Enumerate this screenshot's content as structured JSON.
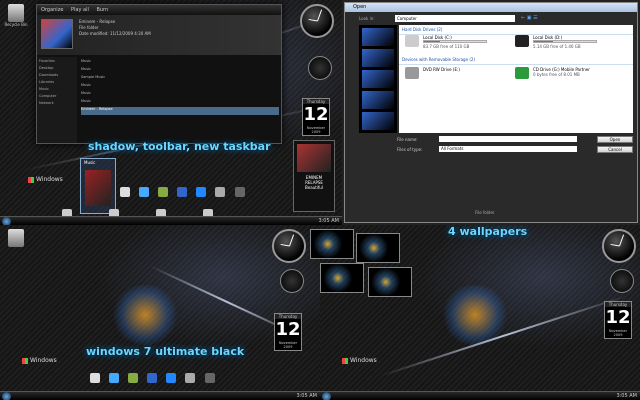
{
  "captions": {
    "top_left": "shadow, toolbar, new taskbar",
    "bottom_left": "windows 7 ultimate black",
    "bottom_right": "4 wallpapers"
  },
  "desktop": {
    "recycle_bin": "Recycle Bin",
    "windows_logo": "Windows",
    "taskbar_time": "3:05 AM"
  },
  "calendar": {
    "day_of_week": "Thursday",
    "day": "12",
    "month_year": "November 2009"
  },
  "explorer": {
    "toolbar": [
      "Organize",
      "Play all",
      "Burn"
    ],
    "meta_lines": [
      "Eminem - Relapse",
      "File folder",
      "Date modified: 11/12/2009 4:30 AM"
    ],
    "nav_items": [
      "Favorites",
      "Desktop",
      "Downloads",
      "Libraries",
      "Music",
      "Computer",
      "Network"
    ],
    "list_items": [
      "Music",
      "Music",
      "Sample Music",
      "Music",
      "Music",
      "Music",
      "Eminem - Relapse"
    ],
    "selected_item": "Eminem - Relapse"
  },
  "media_player": {
    "artist": "EMINEM",
    "album": "RELAPSE",
    "track": "Beautiful"
  },
  "taskbar_preview": {
    "title": "Music"
  },
  "open_dialog": {
    "title": "Open",
    "look_in_label": "Look in:",
    "look_in_value": "Computer",
    "group_hdd": "Hard Disk Drives (2)",
    "group_removable": "Devices with Removable Storage (2)",
    "drives": [
      {
        "name": "Local Disk (C:)",
        "space": "83.7 GB free of 110 GB",
        "used_fraction": 0.25,
        "color": "#4a8ad0"
      },
      {
        "name": "Local Disk (D:)",
        "space": "5.14 GB free of 1.46 GB",
        "used_fraction": 0.3,
        "color": "#222222"
      },
      {
        "name": "DVD RW Drive (E:)",
        "space": "",
        "used_fraction": null,
        "color": "#999999"
      },
      {
        "name": "CD Drive (G:) Mobile Partner",
        "space": "0 bytes free of 8.01 MB",
        "used_fraction": null,
        "color": "#2a9a3a"
      }
    ],
    "file_name_label": "File name:",
    "file_name_value": "",
    "files_of_type_label": "Files of type:",
    "files_of_type_value": "All Formats",
    "open_button": "Open",
    "cancel_button": "Cancel",
    "footer_text": "File folder"
  }
}
